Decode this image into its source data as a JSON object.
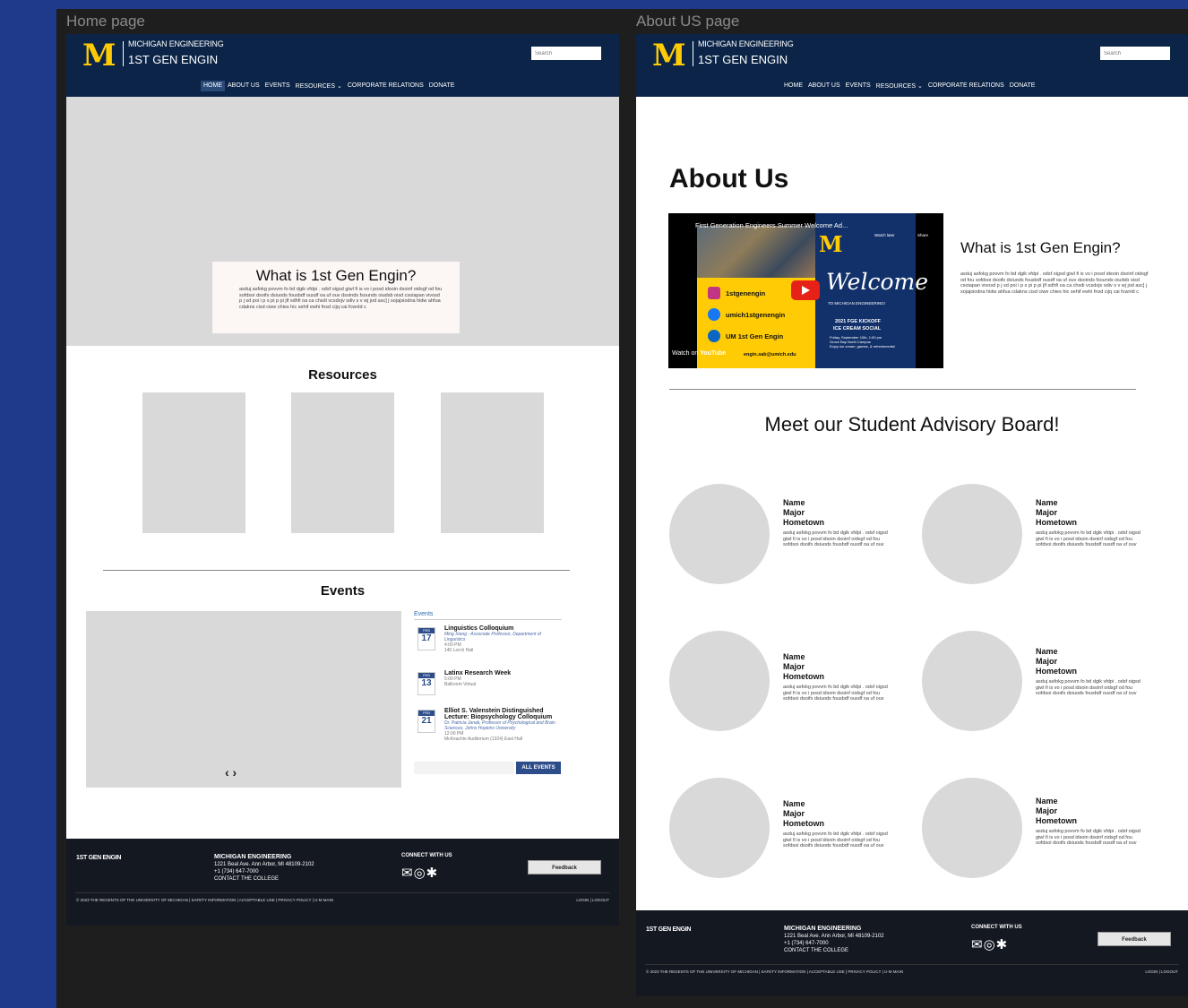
{
  "frames": {
    "home_label": "Home page",
    "about_label": "About US page"
  },
  "header": {
    "logo_letter": "M",
    "brand_line1": "MICHIGAN ENGINEERING",
    "brand_line2": "1ST GEN ENGIN",
    "search_placeholder": "Search",
    "nav": [
      "HOME",
      "ABOUT US",
      "EVENTS",
      "RESOURCES ⌄",
      "CORPORATE RELATIONS",
      "DONATE"
    ]
  },
  "home": {
    "hero": {
      "title": "What is 1st Gen Engin?",
      "text": "asduj asfokg povvm fo bd dgik vfdpi . odsf oigsd giwl fi is vo i posd idsoin dsoinf oidsgf od fou sofdsoi dsoifs dsiuods fousbdf ousdf oa uf ouv dsoinds fsounds oiudsb oisd csoiapan vivosd p j sd poi i p s pi p pi jlf sdhfi oa ca chsdi vcsdojv sdiv s v wj jod asc] j sojajsiodna hidw ahfua cdakns cisd ciwe chies hic sehif ewhi fnsd cijq cai fcwnld c"
    },
    "resources_title": "Resources",
    "events_title": "Events",
    "events": {
      "header": "Events",
      "items": [
        {
          "month": "FEB",
          "day": "17",
          "name": "Linguistics Colloquium",
          "sub": "Ming Xiang - Associate Professor, Department of Linguistics",
          "time": "4:00 PM",
          "place": "140 Lorch Hall"
        },
        {
          "month": "FEB",
          "day": "13",
          "name": "Latinx Research Week",
          "sub": "",
          "time": "5:00 PM",
          "place": "Ballroom Virtual"
        },
        {
          "month": "FEB",
          "day": "21",
          "name": "Elliot S. Valenstein Distinguished Lecture: Biopsychology Colloquium",
          "sub": "Dr. Patricia Janak, Professor of Psychological and Brain Sciences, Johns Hopkins University",
          "time": "12:00 PM",
          "place": "McKeachie Auditorium (1324) East Hall"
        }
      ],
      "all_events_button": "ALL EVENTS",
      "arrows": "‹ ›"
    }
  },
  "footer": {
    "brand": "1ST GEN ENGIN",
    "org": "MICHIGAN ENGINEERING",
    "address": "1221 Beal Ave. Ann Arbor, MI 48109-2102",
    "phone": "+1 (734) 647-7000",
    "contact": "CONTACT THE COLLEGE",
    "connect": "CONNECT WITH US",
    "feedback": "Feedback",
    "legal": "© 2023 THE REGENTS OF THE UNIVERSITY OF MICHIGAN | SAFETY INFORMATION | ACCEPTABLE USE | PRIVACY POLICY | U-M MAIN",
    "login": "LOGIN | LOGOUT"
  },
  "about": {
    "title": "About Us",
    "video": {
      "title": "First Generation Engineers Summer Welcome Ad...",
      "watch_later": "Watch later",
      "share": "Share",
      "welcome": "Welcome",
      "to_michigan": "TO MICHIGAN ENGINEERING!",
      "kickoff": "2021 FGE KICKOFF",
      "ice_cream": "ICE CREAM SOCIAL",
      "details": "Friday, September 10th, 1:00 pm\nGrove Bay North Campus\nEnjoy ice cream, games, & refreshments!",
      "socials": [
        "1stgenengin",
        "umich1stgenengin",
        "UM 1st Gen Engin"
      ],
      "email": "engin.sab@umich.edu",
      "watch_on": "Watch on",
      "youtube": "YouTube"
    },
    "question": "What is 1st Gen Engin?",
    "text": "asduj asfokg povvm fo bd dgik vfdpi . odsf oigsd giwl fi is vo i posd idsoin dsoinf oidsgf od fou sofdsoi dsoifs dsiuods fousbdf ousdf oa uf ouv dsoinds fsounds oiudsb oisd csoiapan vivosd p j sd poi i p s pi p pi jlf sdhfi oa ca chsdi vcsdojv sdiv s v wj jod asc] j sojajsiodna hidw ahfua cdakns cisd ciwe chies hic sehif ewhi fnsd cijq cai fcwnld c",
    "board_title": "Meet our Student Advisory Board!",
    "member": {
      "name": "Name",
      "major": "Major",
      "hometown": "Hometown",
      "bio": "asduj asfokg povvm fo bd dgik vfdpi . odsf oigsd giwl fi is vo i posd idsoin dsoinf oidsgf od fou sofdsoi dsoifs dsiuods fousbdf ousdf oa uf ouv"
    }
  },
  "colors": {
    "navy": "#0b2447",
    "maize": "#ffcb05",
    "placeholder_gray": "#d9d9d9",
    "footer": "#131821",
    "event_blue": "#2d4c8a"
  }
}
